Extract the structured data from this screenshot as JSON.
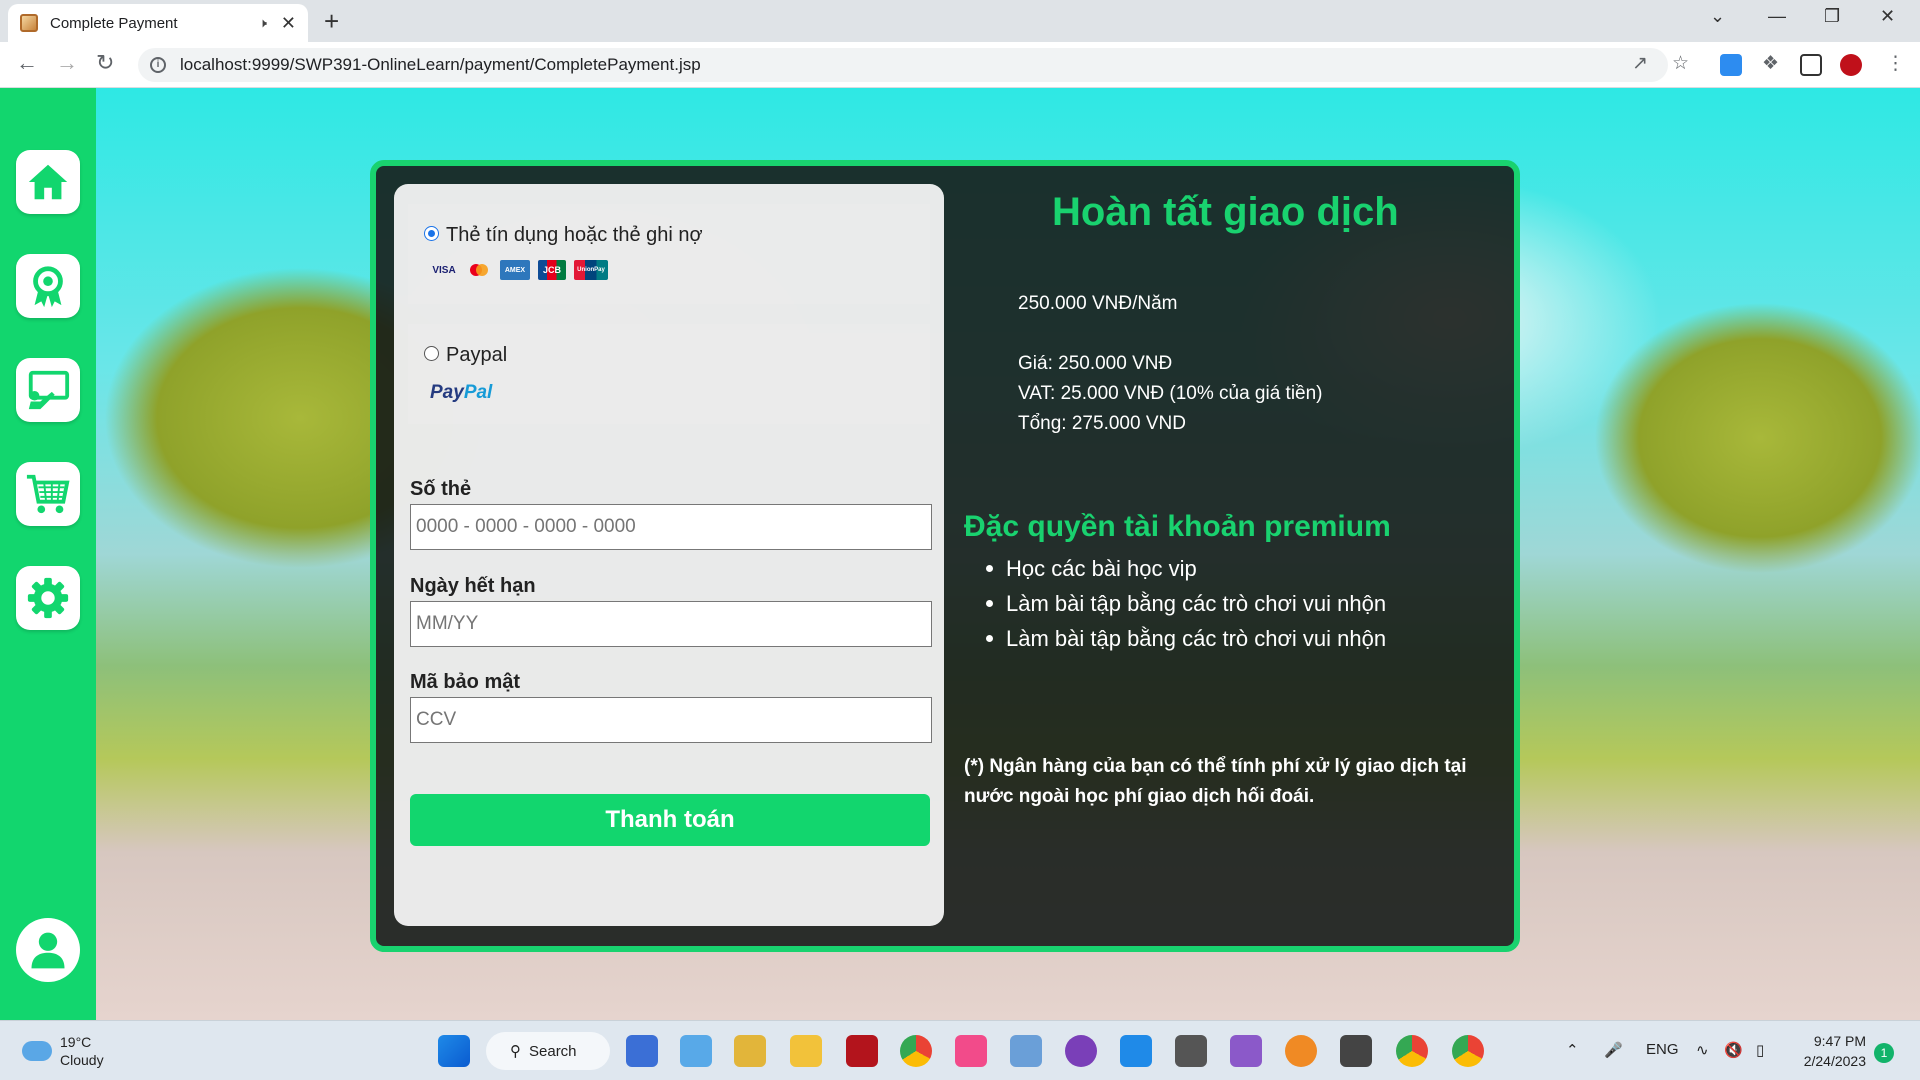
{
  "browser": {
    "tab_title": "Complete Payment",
    "url": "localhost:9999/SWP391-OnlineLearn/payment/CompletePayment.jsp"
  },
  "sidebar": {
    "items": [
      {
        "name": "home-icon"
      },
      {
        "name": "award-icon"
      },
      {
        "name": "teaching-icon"
      },
      {
        "name": "cart-icon"
      },
      {
        "name": "gear-icon"
      }
    ],
    "user": {
      "name": "user-avatar-icon"
    }
  },
  "payment": {
    "options": [
      {
        "label": "Thẻ tín dụng hoặc thẻ ghi nợ",
        "selected": true,
        "cards": [
          "VISA",
          "MC",
          "AMEX",
          "JCB",
          "UnionPay"
        ]
      },
      {
        "label": "Paypal",
        "selected": false,
        "logo_a": "Pay",
        "logo_b": "Pal"
      }
    ],
    "fields": {
      "card_number": {
        "label": "Số thẻ",
        "placeholder": "0000 - 0000 - 0000 - 0000"
      },
      "expiry": {
        "label": "Ngày hết hạn",
        "placeholder": "MM/YY"
      },
      "cvv": {
        "label": "Mã bảo mật",
        "placeholder": "CCV"
      }
    },
    "submit_label": "Thanh toán"
  },
  "summary": {
    "title": "Hoàn tất giao dịch",
    "plan": "250.000 VNĐ/Năm",
    "price": "Giá: 250.000 VNĐ",
    "vat": "VAT: 25.000 VNĐ (10% của giá tiền)",
    "total": "Tổng: 275.000 VND",
    "perks_title": "Đặc quyền tài khoản premium",
    "perks": [
      "Học các bài học vip",
      "Làm bài tập bằng các trò chơi vui nhộn",
      "Làm bài tập bằng các trò chơi vui nhộn"
    ],
    "note": "(*) Ngân hàng của bạn có thể tính phí xử lý giao dịch tại nước ngoài học phí giao dịch hối đoái."
  },
  "taskbar": {
    "temp": "19°C",
    "weather": "Cloudy",
    "search_label": "Search",
    "lang": "ENG",
    "time": "9:47 PM",
    "date": "2/24/2023",
    "notifications": "1"
  },
  "colors": {
    "accent": "#12d66e",
    "panel": "#161c18"
  }
}
